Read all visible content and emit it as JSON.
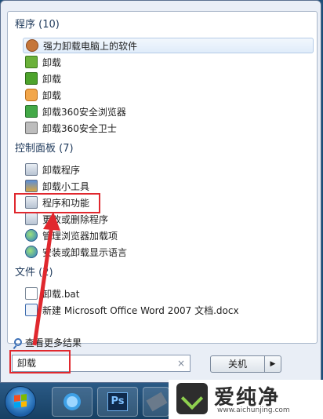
{
  "start_menu": {
    "groups": [
      {
        "title": "程序 (10)",
        "items": [
          {
            "label": "强力卸载电脑上的软件",
            "icon": "uninstall-gear-icon",
            "highlighted": true
          },
          {
            "label": "卸载",
            "icon": "package-icon"
          },
          {
            "label": "卸载",
            "icon": "package-green-icon"
          },
          {
            "label": "卸载",
            "icon": "orange-app-icon"
          },
          {
            "label": "卸载360安全浏览器",
            "icon": "360-browser-icon"
          },
          {
            "label": "卸载360安全卫士",
            "icon": "trash-icon"
          }
        ]
      },
      {
        "title": "控制面板 (7)",
        "items": [
          {
            "label": "卸载程序",
            "icon": "control-panel-icon"
          },
          {
            "label": "卸载小工具",
            "icon": "gadget-icon"
          },
          {
            "label": "程序和功能",
            "icon": "programs-features-icon"
          },
          {
            "label": "更改或删除程序",
            "icon": "control-panel-icon"
          },
          {
            "label": "管理浏览器加载项",
            "icon": "internet-options-icon"
          },
          {
            "label": "安装或卸载显示语言",
            "icon": "globe-icon"
          }
        ]
      },
      {
        "title": "文件 (2)",
        "items": [
          {
            "label": "卸载.bat",
            "icon": "batch-file-icon"
          },
          {
            "label": "新建 Microsoft Office Word 2007 文档.docx",
            "icon": "word-document-icon"
          }
        ]
      }
    ],
    "see_more": "查看更多结果",
    "search": {
      "value": "卸载",
      "clear_glyph": "×"
    },
    "shutdown": {
      "label": "关机",
      "arrow": "▶"
    }
  },
  "taskbar": {
    "buttons": [
      {
        "name": "internet-explorer",
        "icon": "ie-icon"
      },
      {
        "name": "photoshop",
        "icon": "photoshop-icon",
        "text": "Ps"
      },
      {
        "name": "other-app",
        "icon": "app-icon"
      }
    ]
  },
  "watermark": {
    "title": "爱纯净",
    "url": "www.aichunjing.com"
  },
  "colors": {
    "annotation_red": "#e0282e",
    "group_title": "#1e395b",
    "highlight_border": "#b4cbe6"
  }
}
